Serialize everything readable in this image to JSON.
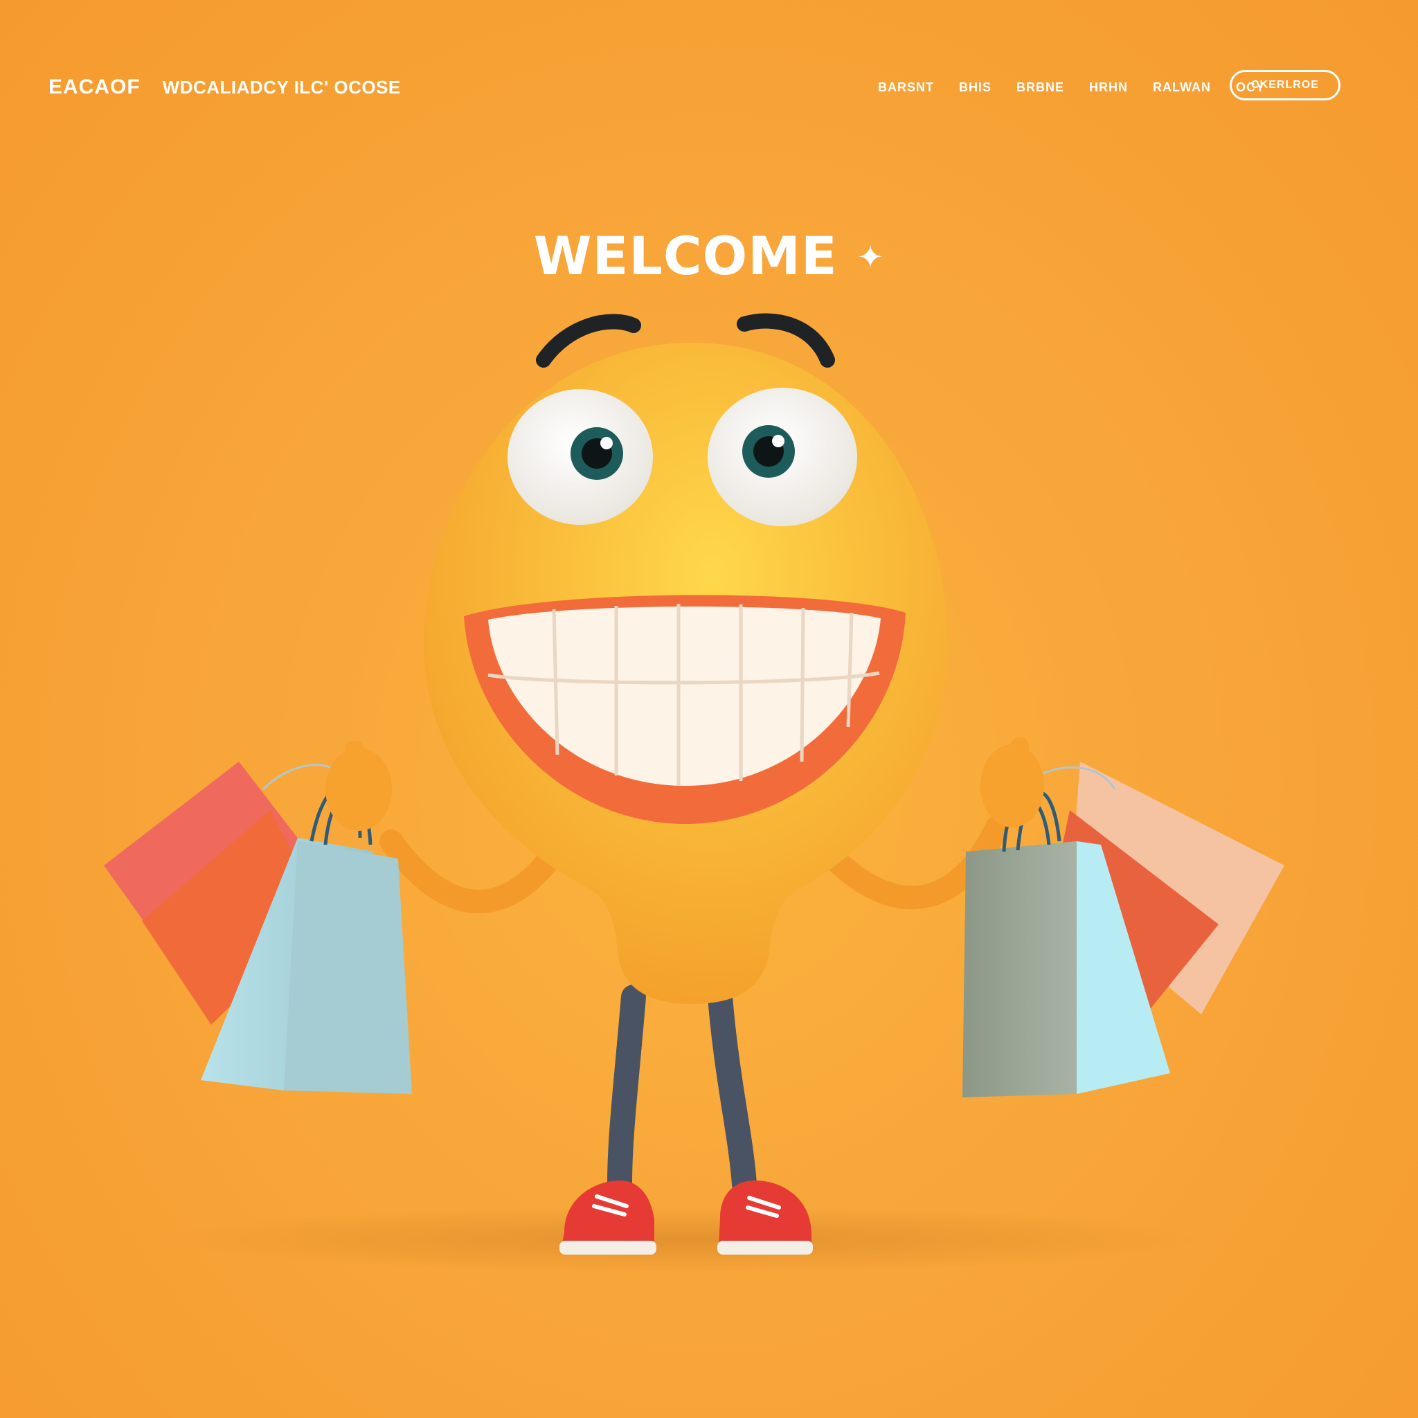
{
  "header": {
    "logo": "EACAOF",
    "tagline": "WDCALIADCY ILC' OCOSE",
    "nav": [
      {
        "label": "BARSNT"
      },
      {
        "label": "BHIS"
      },
      {
        "label": "BRBNE"
      },
      {
        "label": "HRHN"
      },
      {
        "label": "RALWAN"
      },
      {
        "label": "OCY"
      }
    ],
    "cta_label": "CKERLROE"
  },
  "hero": {
    "title": "WELCOME",
    "sparkle": "✦"
  },
  "mascot": {
    "icon": "smiling-shopper-mascot",
    "colors": {
      "background": "#f8a63a",
      "face": "#f8b436",
      "mouth": "#f26b3a",
      "teeth": "#fdf3e6",
      "bag_blue": "#a9d6df",
      "bag_red": "#f26b4f",
      "bag_grey": "#8f9a88",
      "shoes": "#e63a35",
      "legs": "#4a5363"
    }
  }
}
